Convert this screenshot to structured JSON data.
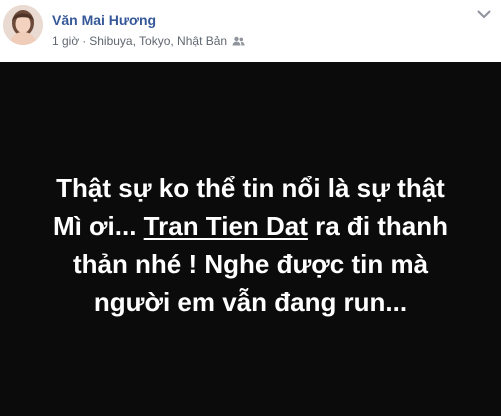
{
  "post": {
    "author": {
      "name": "Văn Mai Hương"
    },
    "meta": {
      "time": "1 giờ",
      "separator": "·",
      "location": "Shibuya, Tokyo, Nhật Bản",
      "audience_icon": "friends-icon"
    },
    "more_icon": "chevron-down-icon",
    "status": {
      "background_color": "#0b0b0b",
      "text_color": "#ffffff",
      "line1": "Thật sự ko thể tin nổi là sự thật",
      "line2_before": "Mì ơi... ",
      "mention": "Tran Tien Dat",
      "line2_after": " ra đi thanh",
      "line3": "thản nhé ! Nghe được tin mà",
      "line4": "người em vẫn đang run..."
    }
  },
  "colors": {
    "author_link": "#365899",
    "meta_text": "#616770"
  }
}
